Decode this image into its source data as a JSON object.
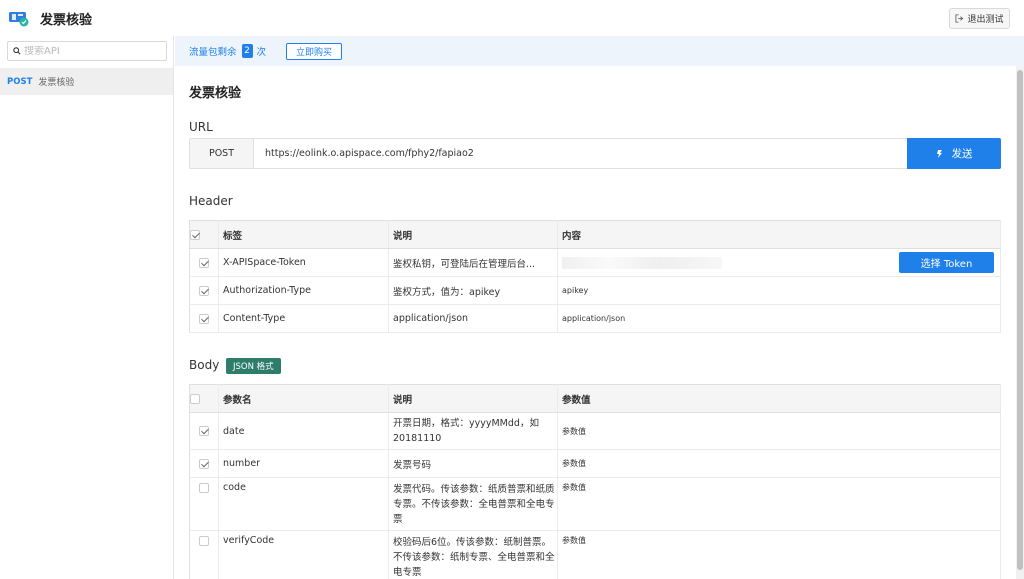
{
  "app": {
    "title": "发票核验",
    "exit_label": "退出测试"
  },
  "sidebar": {
    "search_placeholder": "搜索API",
    "items": [
      {
        "method": "POST",
        "label": "发票核验"
      }
    ]
  },
  "credit": {
    "prefix": "流量包剩余",
    "count": "2",
    "suffix": "次",
    "buy_label": "立即购买"
  },
  "page": {
    "heading": "发票核验"
  },
  "url": {
    "section": "URL",
    "method": "POST",
    "value": "https://eolink.o.apispace.com/fphy2/fapiao2",
    "send_label": "发送"
  },
  "header": {
    "section": "Header",
    "columns": [
      "标签",
      "说明",
      "内容"
    ],
    "rows": [
      {
        "key": "X-APISpace-Token",
        "desc": "鉴权私钥，可登陆后在管理后台...",
        "value": "",
        "action": "选择 Token"
      },
      {
        "key": "Authorization-Type",
        "desc": "鉴权方式，值为：apikey",
        "value": "apikey"
      },
      {
        "key": "Content-Type",
        "desc": "application/json",
        "value": "application/json"
      }
    ]
  },
  "body": {
    "section": "Body",
    "format_tag": "JSON 格式",
    "columns": [
      "参数名",
      "说明",
      "参数值"
    ],
    "rows": [
      {
        "name": "date",
        "checked": true,
        "desc": "开票日期，格式：yyyyMMdd，如20181110",
        "placeholder": "参数值"
      },
      {
        "name": "number",
        "checked": true,
        "desc": "发票号码",
        "placeholder": "参数值"
      },
      {
        "name": "code",
        "checked": false,
        "desc": "发票代码。传该参数：纸质普票和纸质专票。不传该参数：全电普票和全电专票",
        "placeholder": "参数值"
      },
      {
        "name": "verifyCode",
        "checked": false,
        "desc": "校验码后6位。传该参数：纸制普票。不传该参数：纸制专票、全电普票和全电专票",
        "placeholder": "参数值"
      }
    ]
  },
  "colors": {
    "accent": "#1e80e8",
    "tag": "#2e7d6b"
  }
}
